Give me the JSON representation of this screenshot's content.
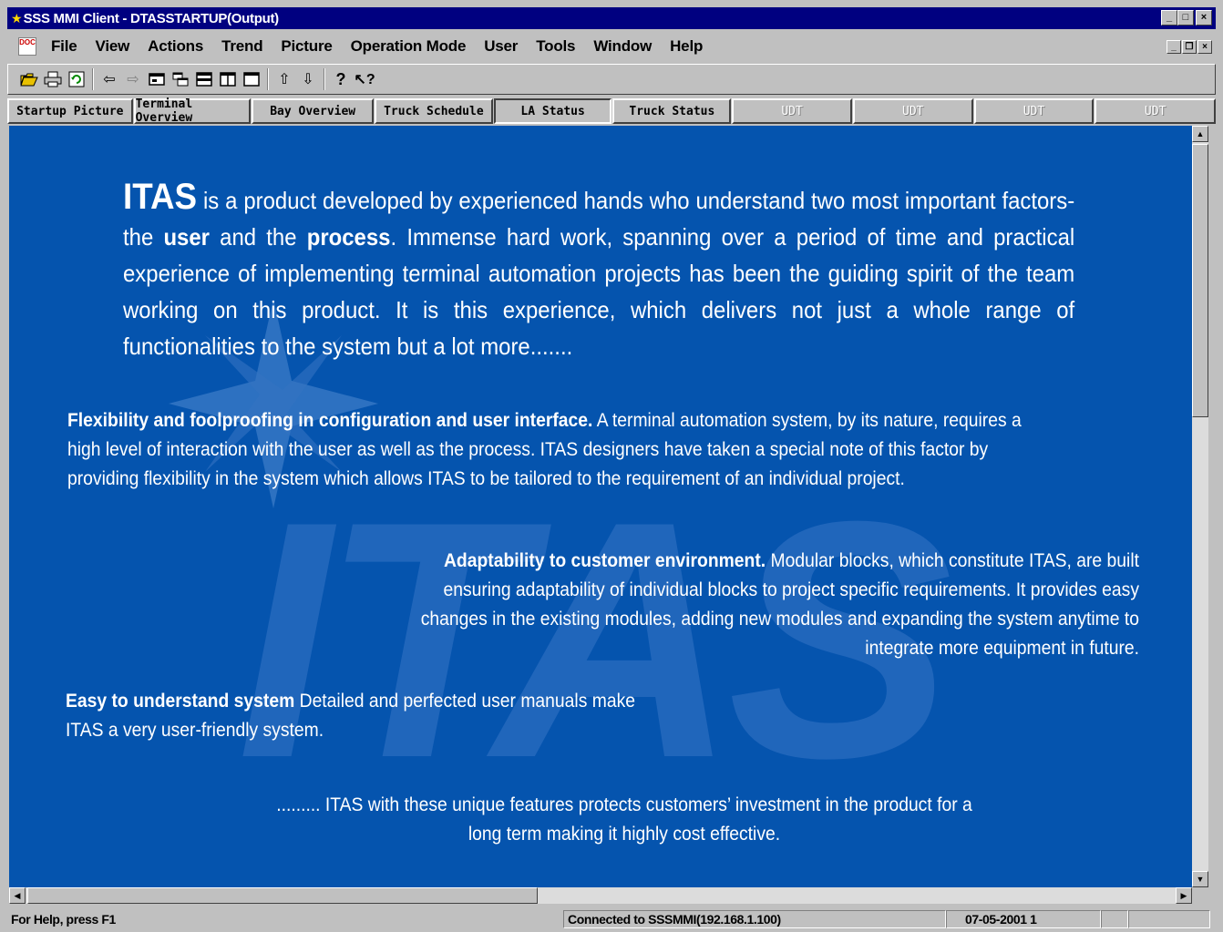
{
  "window": {
    "title": "SSS MMI Client - DTASSTARTUP(Output)",
    "app_icon": "star-icon",
    "controls": [
      "_",
      "□",
      "×"
    ]
  },
  "menu": {
    "doc_icon": "document-icon",
    "items": [
      "File",
      "View",
      "Actions",
      "Trend",
      "Picture",
      "Operation Mode",
      "User",
      "Tools",
      "Window",
      "Help"
    ],
    "mdi_controls": [
      "_",
      "❐",
      "×"
    ]
  },
  "toolbar": {
    "icons": [
      "open-folder-icon",
      "print-icon",
      "refresh-icon",
      "back-arrow-icon",
      "forward-arrow-icon",
      "panel-icon",
      "cascade-icon",
      "tile-horizontal-icon",
      "tile-vertical-icon",
      "window-icon",
      "up-arrow-icon",
      "down-arrow-icon",
      "help-icon",
      "context-help-icon"
    ]
  },
  "nav": {
    "buttons": [
      {
        "label": "Startup Picture",
        "state": "normal"
      },
      {
        "label": "Terminal Overview",
        "state": "normal"
      },
      {
        "label": "Bay Overview",
        "state": "normal"
      },
      {
        "label": "Truck Schedule",
        "state": "normal"
      },
      {
        "label": "LA Status",
        "state": "pressed"
      },
      {
        "label": "Truck Status",
        "state": "normal"
      },
      {
        "label": "UDT",
        "state": "disabled"
      },
      {
        "label": "UDT",
        "state": "disabled"
      },
      {
        "label": "UDT",
        "state": "disabled"
      },
      {
        "label": "UDT",
        "state": "disabled"
      }
    ]
  },
  "content": {
    "background_color": "#0554ae",
    "watermark": "ITAS",
    "intro": {
      "lead": "ITAS",
      "part1": " is a product developed by experienced hands who understand two most important factors-the ",
      "user": "user",
      "part2": " and the ",
      "process": "process",
      "part3": ". Immense hard work, spanning over a period of time and practical experience of implementing terminal automation projects has been the guiding spirit of the team working on this product. It is this experience, which delivers not just a whole range of functionalities to the system but a lot more......."
    },
    "flexibility": {
      "heading": "Flexibility and foolproofing in configuration and user interface.",
      "body": " A terminal automation system, by its nature, requires a high level of interaction with the user as well as the process. ITAS designers have taken a special note of this factor by providing flexibility in the system which allows ITAS to be tailored to the requirement of an individual project."
    },
    "adaptability": {
      "heading": "Adaptability to customer environment.",
      "body": " Modular blocks, which constitute ITAS, are built ensuring adaptability of individual blocks to project specific requirements. It provides easy changes in the existing modules, adding new modules and expanding the system anytime to integrate more equipment in future."
    },
    "easy": {
      "heading": "Easy to understand system",
      "body": " Detailed and perfected user manuals make ITAS a very user-friendly system."
    },
    "closing": "......... ITAS with these unique features protects customers’ investment in the product for a long term making it highly cost effective."
  },
  "status": {
    "help": "For Help, press F1",
    "connection": "Connected to SSSMMI(192.168.1.100)",
    "date": "07-05-2001 1"
  }
}
